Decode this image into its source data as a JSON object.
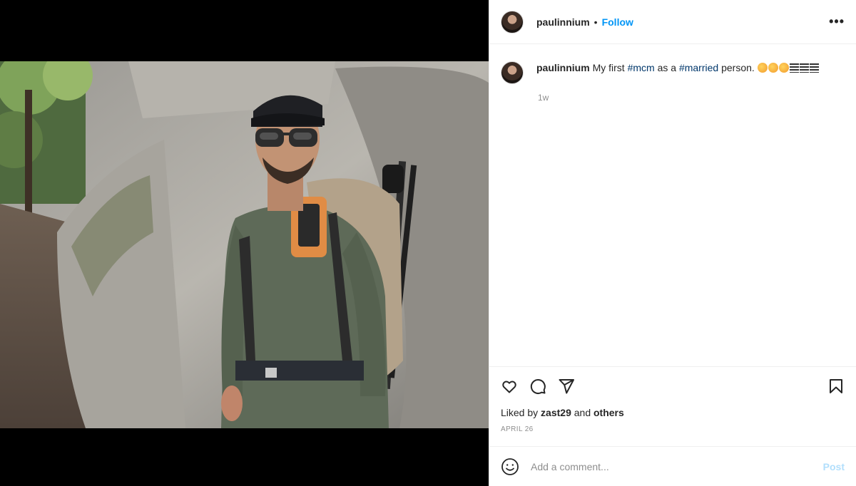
{
  "post": {
    "username": "paulinnium",
    "follow_label": "Follow",
    "separator": "•",
    "more_label": "•••",
    "caption": {
      "username": "paulinnium",
      "text_1": "My first",
      "tag_1": "#mcm",
      "text_2": "as a",
      "tag_2": "#married",
      "text_3": "person.",
      "time": "1w"
    },
    "likes": {
      "prefix": "Liked by",
      "user": "zast29",
      "middle": "and",
      "others": "others"
    },
    "date": "APRIL 26"
  },
  "comment_box": {
    "placeholder": "Add a comment...",
    "post_label": "Post"
  },
  "colors": {
    "accent": "#0095f6",
    "hashtag": "#00376b",
    "post_disabled": "#b2dffc",
    "muted": "#8e8e8e"
  },
  "icons": [
    "heart-icon",
    "comment-icon",
    "share-icon",
    "bookmark-icon",
    "smiley-icon",
    "more-icon"
  ]
}
